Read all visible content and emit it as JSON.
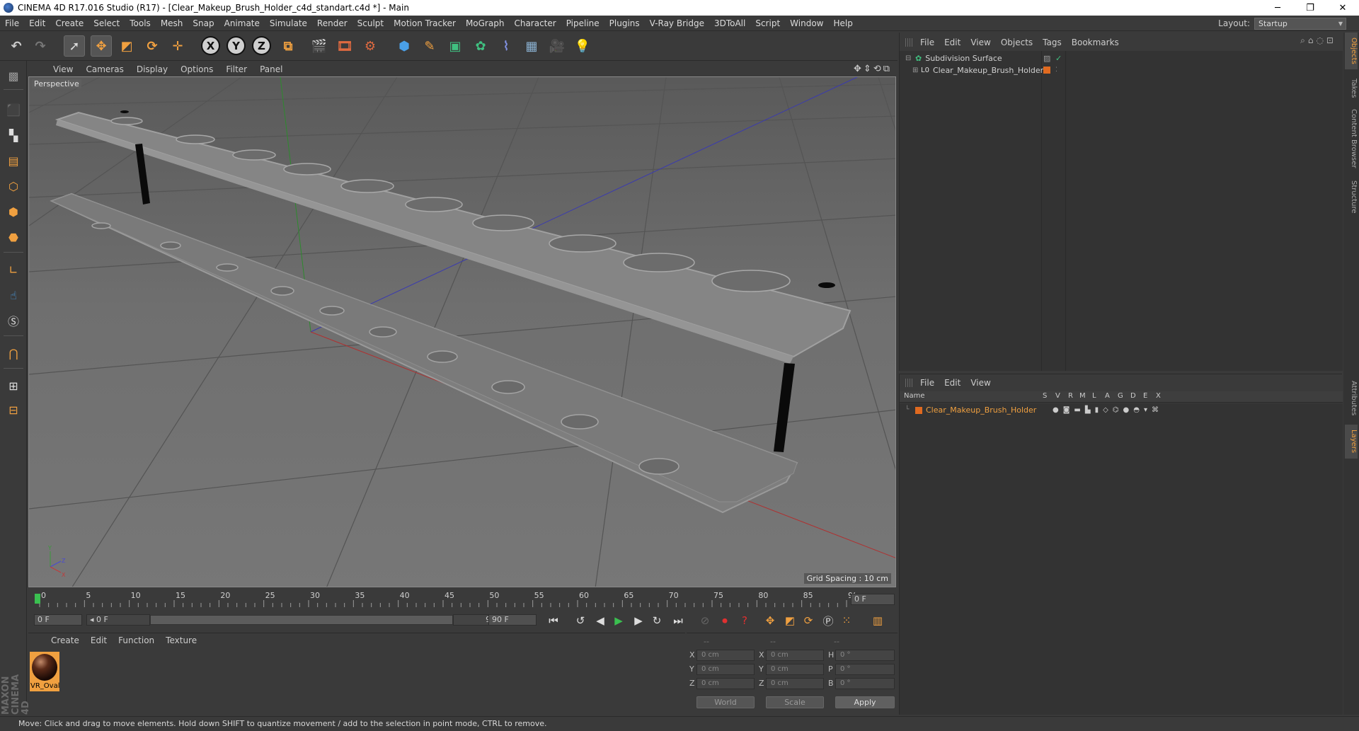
{
  "window": {
    "title": "CINEMA 4D R17.016 Studio (R17) - [Clear_Makeup_Brush_Holder_c4d_standart.c4d *] - Main",
    "minimize": "─",
    "maximize": "❐",
    "close": "✕"
  },
  "menu": [
    "File",
    "Edit",
    "Create",
    "Select",
    "Tools",
    "Mesh",
    "Snap",
    "Animate",
    "Simulate",
    "Render",
    "Sculpt",
    "Motion Tracker",
    "MoGraph",
    "Character",
    "Pipeline",
    "Plugins",
    "V-Ray Bridge",
    "3DToAll",
    "Script",
    "Window",
    "Help"
  ],
  "layout": {
    "label": "Layout:",
    "value": "Startup"
  },
  "toolbar": {
    "x_axis": "X",
    "y_axis": "Y",
    "z_axis": "Z"
  },
  "viewport": {
    "menu": [
      "View",
      "Cameras",
      "Display",
      "Options",
      "Filter",
      "Panel"
    ],
    "label": "Perspective",
    "grid_spacing": "Grid Spacing : 10 cm"
  },
  "timeline": {
    "ticks": [
      "0",
      "5",
      "10",
      "15",
      "20",
      "25",
      "30",
      "35",
      "40",
      "45",
      "50",
      "55",
      "60",
      "65",
      "70",
      "75",
      "80",
      "85",
      "90"
    ],
    "current_frame": "0 F",
    "start": "0 F",
    "range_start": "◂ 0 F",
    "range_end": "90 F ▸",
    "end": "90 F"
  },
  "material_panel": {
    "menu": [
      "Create",
      "Edit",
      "Function",
      "Texture"
    ],
    "material_name": "VR_Oval"
  },
  "coordinates": {
    "headers": [
      "--",
      "--",
      "--"
    ],
    "rows": [
      {
        "axis": "X",
        "pos": "0 cm",
        "axis2": "X",
        "size": "0 cm",
        "rot_label": "H",
        "rot": "0 °"
      },
      {
        "axis": "Y",
        "pos": "0 cm",
        "axis2": "Y",
        "size": "0 cm",
        "rot_label": "P",
        "rot": "0 °"
      },
      {
        "axis": "Z",
        "pos": "0 cm",
        "axis2": "Z",
        "size": "0 cm",
        "rot_label": "B",
        "rot": "0 °"
      }
    ],
    "mode": "World",
    "scale": "Scale",
    "apply": "Apply"
  },
  "objects_panel": {
    "menu": [
      "File",
      "Edit",
      "View",
      "Objects",
      "Tags",
      "Bookmarks"
    ],
    "items": [
      {
        "name": "Subdivision Surface"
      },
      {
        "name": "Clear_Makeup_Brush_Holder"
      }
    ]
  },
  "layers_panel": {
    "menu": [
      "File",
      "Edit",
      "View"
    ],
    "columns": [
      "Name",
      "S",
      "V",
      "R",
      "M",
      "L",
      "A",
      "G",
      "D",
      "E",
      "X"
    ],
    "items": [
      {
        "name": "Clear_Makeup_Brush_Holder"
      }
    ]
  },
  "right_tabs": [
    "Objects",
    "Takes",
    "Content Browser",
    "Structure",
    "Attributes",
    "Layers"
  ],
  "status": "Move: Click and drag to move elements. Hold down SHIFT to quantize movement / add to the selection in point mode, CTRL to remove.",
  "branding": "MAXON CINEMA 4D",
  "colors": {
    "accent": "#f0a040",
    "layer": "#e06a20",
    "timeline_marker": "#3ac050"
  }
}
